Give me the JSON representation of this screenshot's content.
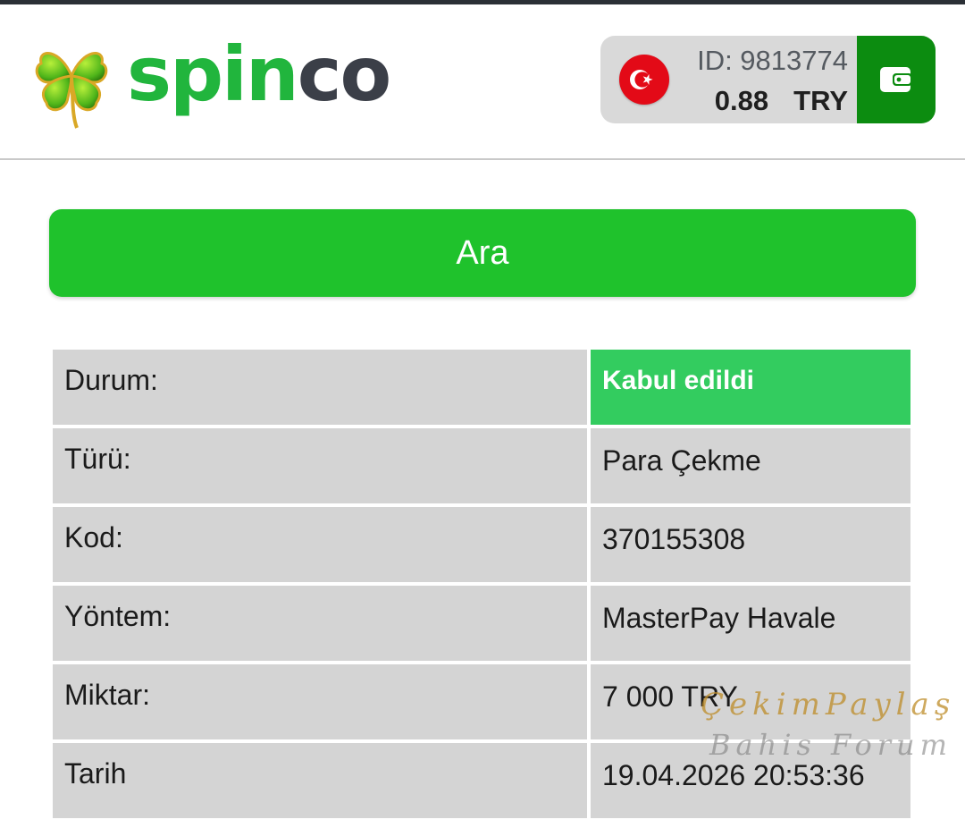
{
  "brand": {
    "name_part1": "spin",
    "name_part2": "co",
    "colors": {
      "green": "#21b53d",
      "dark": "#3b3f48"
    }
  },
  "account": {
    "flag_icon": "turkey-flag-icon",
    "id_text": "ID: 9813774",
    "balance": "0.88",
    "currency": "TRY",
    "wallet_icon": "wallet-icon"
  },
  "search": {
    "label": "Ara"
  },
  "details": {
    "rows": [
      {
        "label": "Durum:",
        "value": "Kabul edildi"
      },
      {
        "label": "Türü:",
        "value": "Para Çekme"
      },
      {
        "label": "Kod:",
        "value": "370155308"
      },
      {
        "label": "Yöntem:",
        "value": "MasterPay Havale"
      },
      {
        "label": "Miktar:",
        "value": "7 000 TRY"
      },
      {
        "label": "Tarih",
        "value": "19.04.2026 20:53:36"
      }
    ]
  },
  "watermark": {
    "line1": "ÇekimPaylaş",
    "line2": "Bahis Forum"
  },
  "colors": {
    "accent_green": "#1fc22c",
    "status_green": "#33cc5f",
    "wallet_green": "#0c8c10",
    "cell_gray": "#d4d4d4"
  }
}
